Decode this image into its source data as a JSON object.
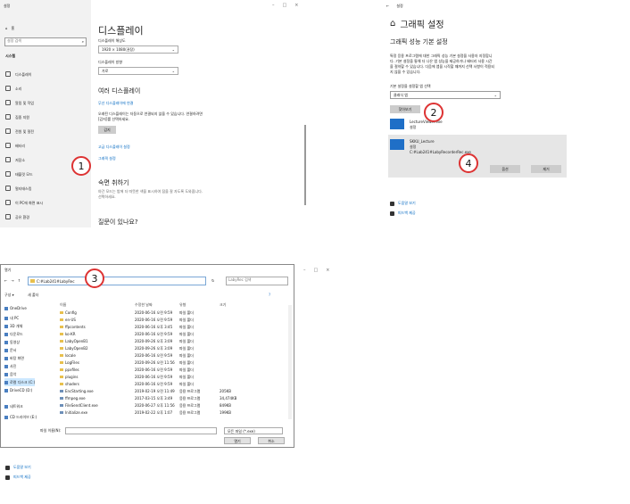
{
  "panel1": {
    "window_title": "설정",
    "window_controls": [
      "–",
      "□",
      "×"
    ],
    "home": "홈",
    "search_placeholder": "설정 검색",
    "system_label": "시스템",
    "sidebar": [
      "디스플레이",
      "소리",
      "알림 및 작업",
      "집중 지원",
      "전원 및 절전",
      "배터리",
      "저장소",
      "태블릿 모드",
      "멀티태스킹",
      "이 PC에 화면 표시",
      "공유 환경"
    ],
    "page_title": "디스플레이",
    "resolution_label": "디스플레이 해상도",
    "resolution_value": "1920 × 1080(권장)",
    "orientation_label": "디스플레이 방향",
    "orientation_value": "가로",
    "multi_display_heading": "여러 디스플레이",
    "wireless_link": "무선 디스플레이에 연결",
    "detect_text_1": "오래된 디스플레이는 자동으로 연결되지 않을 수 있습니다. 연결하려면",
    "detect_text_2": "[감지]를 선택하세요.",
    "detect_button": "감지",
    "advanced_link": "고급 디스플레이 설정",
    "graphics_link": "그래픽 설정",
    "sleep_heading": "숙면 취하기",
    "sleep_text_1": "야간 모드는 밤에 더 따뜻한 색을 표시하여 잠을 잘 자도록 도와줍니다.",
    "sleep_text_2": "선택하세요.",
    "question_heading": "질문이 있나요?"
  },
  "panel2": {
    "back": "←",
    "window_title": "설정",
    "page_title": "그래픽 설정",
    "section_title": "그래픽 성능 기본 설정",
    "desc_1": "특정 응용 프로그램에 대한 그래픽 성능 기본 설정을 사용자 지정합니",
    "desc_2": "다. 기본 설정을 통해 더 나은 앱 성능을 제공하거나 배터리 사용 시간",
    "desc_3": "을 절약할 수 있습니다. 다음에 앱을 시작할 때까지 선택 사항이 적용되",
    "desc_4": "지 않을 수 있습니다.",
    "select_label": "기본 설정을 설정할 앱 선택",
    "select_value": "클래식 앱",
    "browse_button": "찾아보기",
    "app1_name": "LectureViewer.exe",
    "app1_state": "설정",
    "app2_name": "SKKU_Lecture",
    "app2_state": "설정",
    "app2_path": "C:#Lab241#LabyRecorderRec.exe",
    "options_button": "옵션",
    "remove_button": "제거",
    "help_link": "도움말 보기",
    "feedback_link": "피드백 제공"
  },
  "panel3": {
    "window_title": "열기",
    "address": "C:#Lab241#LabyRec",
    "search_placeholder": "LabyRec 검색",
    "organize": "구성 ▾",
    "new_folder": "새 폴더",
    "columns": [
      "이름",
      "수정한 날짜",
      "유형",
      "크기"
    ],
    "nav": [
      "OneDrive",
      "내 PC",
      "3D 개체",
      "다운로드",
      "동영상",
      "문서",
      "바탕 화면",
      "사진",
      "음악",
      "로컬 디스크 (C:)",
      "DriveCD (D:)",
      "네트워크",
      "CD 드라이브 (E:)"
    ],
    "files": [
      [
        "Config",
        "2020-06-16 오전 9:59",
        "파일 폴더",
        ""
      ],
      [
        "en-US",
        "2020-06-16 오전 9:59",
        "파일 폴더",
        ""
      ],
      [
        "ffpcontents",
        "2020-06-16 오후 3:45",
        "파일 폴더",
        ""
      ],
      [
        "ko-KR",
        "2020-06-16 오전 9:59",
        "파일 폴더",
        ""
      ],
      [
        "LabyOpenB1",
        "2020-09-26 오후 3:09",
        "파일 폴더",
        ""
      ],
      [
        "LabyOpenB2",
        "2020-09-26 오후 3:09",
        "파일 폴더",
        ""
      ],
      [
        "locale",
        "2020-06-16 오전 9:59",
        "파일 폴더",
        ""
      ],
      [
        "LogFiles",
        "2020-09-26 오전 11:56",
        "파일 폴더",
        ""
      ],
      [
        "ppxfiles",
        "2020-06-16 오전 9:59",
        "파일 폴더",
        ""
      ],
      [
        "plugins",
        "2020-06-16 오전 9:59",
        "파일 폴더",
        ""
      ],
      [
        "shaders",
        "2020-06-16 오전 9:59",
        "파일 폴더",
        ""
      ],
      [
        "EncStarting.exe",
        "2019-02-19 오전 11:49",
        "응용 프로그램",
        "205KB"
      ],
      [
        "ffmpeg.exe",
        "2017-03-15 오후 3:49",
        "응용 프로그램",
        "34,474KB"
      ],
      [
        "FileSendClient.exe",
        "2020-06-27 오후 11:56",
        "응용 프로그램",
        "849KB"
      ],
      [
        "Initialize.exe",
        "2019-02-22 오후 1:07",
        "응용 프로그램",
        "199KB"
      ]
    ],
    "filename_label": "파일 이름(N):",
    "filetype_value": "모든 파일 (*.exe)",
    "open_button": "열기",
    "cancel_button": "취소",
    "help_link": "도움말 보기",
    "feedback_link": "피드백 제공"
  },
  "markers": [
    "1",
    "2",
    "3",
    "4"
  ]
}
